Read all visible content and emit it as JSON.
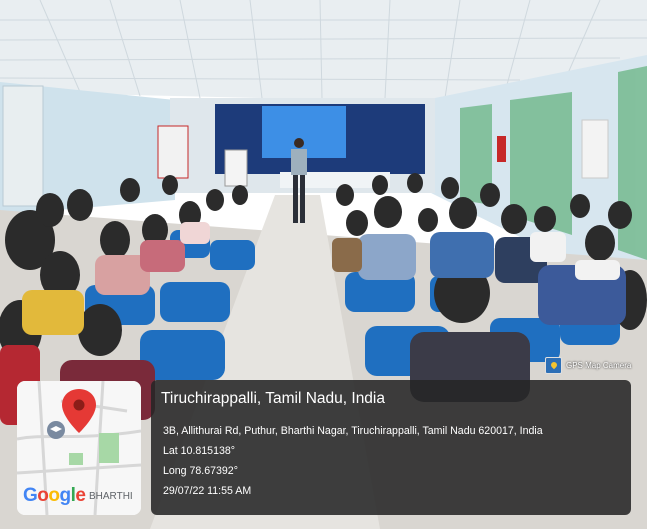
{
  "watermark": {
    "label": "GPS Map Camera",
    "icon": "gps-map-camera-logo-icon"
  },
  "map_card": {
    "brand": "Google",
    "area_label": "BHARTHI",
    "icon": "location-pin-icon"
  },
  "location": {
    "title": "Tiruchirappalli, Tamil Nadu, India",
    "address": "3B, Allithurai Rd, Puthur, Bharthi Nagar, Tiruchirappalli, Tamil Nadu 620017, India",
    "latitude": "Lat 10.815138°",
    "longitude": "Long 78.67392°",
    "timestamp": "29/07/22 11:55 AM"
  },
  "colors": {
    "overlay": "#262626",
    "pin": "#e53935",
    "curtain": "#7fbf99",
    "wall": "#d7e6ef",
    "chair": "#1f6fc0"
  }
}
